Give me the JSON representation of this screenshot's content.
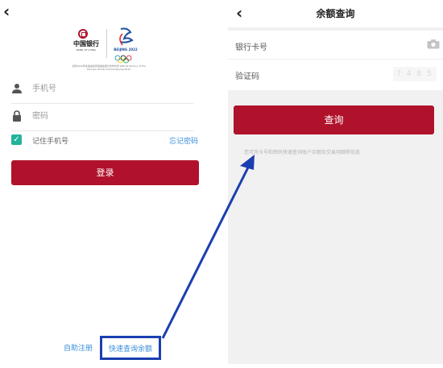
{
  "left": {
    "back_icon": "back-arrow-icon",
    "bank_name_cn": "中国银行",
    "bank_name_en": "BANK OF CHINA",
    "olympic_text": "BEIJING 2022",
    "sponsor_text": "北京2022年冬奥会和冬残奥会官方合作伙伴 Official Partner of the Olympic Winter Games Beijing 2022",
    "phone_placeholder": "手机号",
    "password_placeholder": "密码",
    "remember_label": "记住手机号",
    "forgot_label": "忘记密码",
    "login_label": "登录",
    "self_register_label": "自助注册",
    "quick_query_label": "快速查询余额"
  },
  "right": {
    "back_icon": "back-arrow-icon",
    "title": "余额查询",
    "card_label": "银行卡号",
    "captcha_label": "验证码",
    "captcha_value": "7 4 8 5",
    "query_label": "查询",
    "hint_text": "您可凭卡号和密码快速查询账户余额及交易明细等信息"
  },
  "colors": {
    "brand_red": "#b0122b",
    "link_blue": "#3a8fd9",
    "checkbox_green": "#23b39b",
    "highlight_blue": "#1b3fb0"
  }
}
